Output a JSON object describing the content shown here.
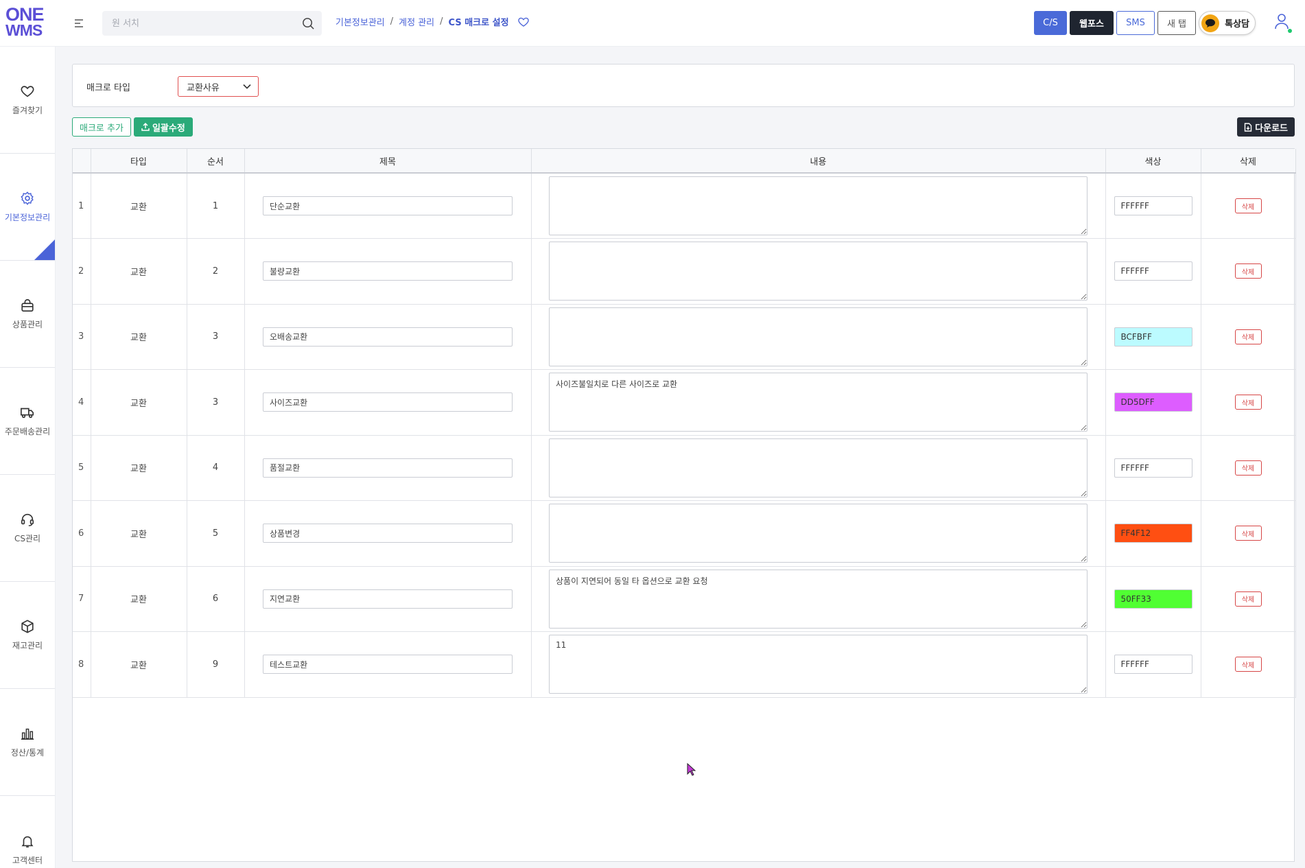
{
  "header": {
    "logo_line1": "ONE",
    "logo_line2": "WMS",
    "search_placeholder": "원 서치",
    "breadcrumb": [
      "기본정보관리",
      "계정 관리",
      "CS 매크로 설정"
    ],
    "buttons": {
      "cs": "C/S",
      "web": "웹포스",
      "sms": "SMS",
      "newtab": "새 탭",
      "chat": "톡상담"
    }
  },
  "sidebar": {
    "items": [
      {
        "label": "즐겨찾기",
        "icon": "heart-icon"
      },
      {
        "label": "기본정보관리",
        "icon": "gear-icon",
        "active": true
      },
      {
        "label": "상품관리",
        "icon": "bag-icon"
      },
      {
        "label": "주문배송관리",
        "icon": "truck-icon"
      },
      {
        "label": "CS관리",
        "icon": "headset-icon"
      },
      {
        "label": "재고관리",
        "icon": "box-icon"
      },
      {
        "label": "정산/통계",
        "icon": "bar-chart-icon"
      },
      {
        "label": "고객센터",
        "icon": "bell-icon"
      }
    ]
  },
  "filter": {
    "label": "매크로 타입",
    "selected": "교환사유"
  },
  "actions": {
    "add": "매크로 추가",
    "bulk": "일괄수정",
    "download": "다운로드"
  },
  "table": {
    "columns": [
      "",
      "타입",
      "순서",
      "제목",
      "내용",
      "색상",
      "삭제"
    ],
    "delete_label": "삭제",
    "rows": [
      {
        "no": "1",
        "type": "교환",
        "order": "1",
        "title": "단순교환",
        "content": "",
        "color": "FFFFFF",
        "bg": "#FFFFFF"
      },
      {
        "no": "2",
        "type": "교환",
        "order": "2",
        "title": "불량교환",
        "content": "",
        "color": "FFFFFF",
        "bg": "#FFFFFF"
      },
      {
        "no": "3",
        "type": "교환",
        "order": "3",
        "title": "오배송교환",
        "content": "",
        "color": "BCFBFF",
        "bg": "#BCFBFF"
      },
      {
        "no": "4",
        "type": "교환",
        "order": "3",
        "title": "사이즈교환",
        "content": "사이즈불일치로 다른 사이즈로 교환",
        "color": "DD5DFF",
        "bg": "#DD5DFF"
      },
      {
        "no": "5",
        "type": "교환",
        "order": "4",
        "title": "품절교환",
        "content": "",
        "color": "FFFFFF",
        "bg": "#FFFFFF"
      },
      {
        "no": "6",
        "type": "교환",
        "order": "5",
        "title": "상품변경",
        "content": "",
        "color": "FF4F12",
        "bg": "#FF4F12"
      },
      {
        "no": "7",
        "type": "교환",
        "order": "6",
        "title": "지연교환",
        "content": "상품이 지연되어 동일 타 옵션으로 교환 요청",
        "color": "50FF33",
        "bg": "#50FF33"
      },
      {
        "no": "8",
        "type": "교환",
        "order": "9",
        "title": "테스트교환",
        "content": "11",
        "color": "FFFFFF",
        "bg": "#FFFFFF"
      }
    ]
  }
}
